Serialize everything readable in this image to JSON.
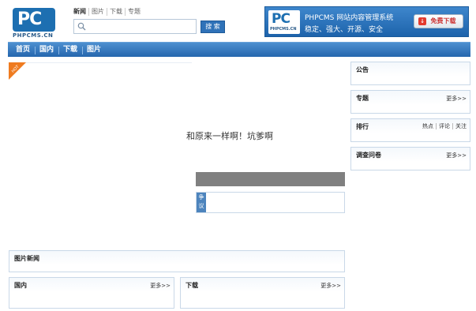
{
  "header": {
    "logo_mark": "PC",
    "logo_text": "PHPCMS.CN",
    "search_tabs": [
      "新闻",
      "图片",
      "下载",
      "专题"
    ],
    "search_placeholder": "",
    "search_button": "搜 索"
  },
  "banner": {
    "logo_mark": "PC",
    "logo_text": "PHPCMS.CN",
    "line1": "PHPCMS 网站内容管理系统",
    "line2": "稳定、强大、开源、安全",
    "download_label": "免费下载"
  },
  "nav": [
    "首页",
    "国内",
    "下载",
    "图片"
  ],
  "main": {
    "hot_badge": "HOT",
    "center_text": "和原来一样啊！坑爹啊",
    "debate_label": "争议"
  },
  "sidebar": {
    "announcement": {
      "title": "公告"
    },
    "topics": {
      "title": "专题",
      "more": "更多>>"
    },
    "ranking": {
      "title": "排行",
      "links": [
        "热点",
        "评论",
        "关注"
      ]
    },
    "survey": {
      "title": "调查问卷",
      "more": "更多>>"
    }
  },
  "sections": {
    "photo_news": {
      "title": "图片新闻"
    },
    "domestic": {
      "title": "国内",
      "more": "更多>>"
    },
    "download": {
      "title": "下载",
      "more": "更多>>"
    }
  },
  "colors": {
    "brand_blue": "#1d6fb1",
    "nav_blue": "#2566ad",
    "panel_border": "#c9d8e8",
    "gray_bar": "#808080",
    "download_red": "#e23a2e"
  }
}
